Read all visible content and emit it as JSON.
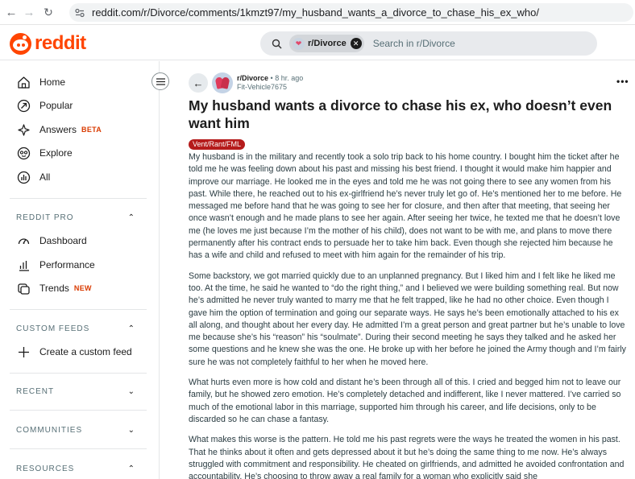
{
  "browser": {
    "url": "reddit.com/r/Divorce/comments/1kmzt97/my_husband_wants_a_divorce_to_chase_his_ex_who/"
  },
  "header": {
    "logo_text": "reddit",
    "search": {
      "chip_label": "r/Divorce",
      "placeholder": "Search in r/Divorce"
    }
  },
  "sidebar": {
    "nav": [
      {
        "label": "Home",
        "icon": "home-icon"
      },
      {
        "label": "Popular",
        "icon": "popular-icon"
      },
      {
        "label": "Answers",
        "badge": "BETA",
        "icon": "answers-icon"
      },
      {
        "label": "Explore",
        "icon": "explore-icon"
      },
      {
        "label": "All",
        "icon": "all-icon"
      }
    ],
    "reddit_pro": {
      "heading": "REDDIT PRO",
      "items": [
        {
          "label": "Dashboard",
          "icon": "dashboard-icon"
        },
        {
          "label": "Performance",
          "icon": "performance-icon"
        },
        {
          "label": "Trends",
          "badge": "NEW",
          "icon": "trends-icon"
        }
      ]
    },
    "custom_feeds": {
      "heading": "CUSTOM FEEDS",
      "create_label": "Create a custom feed"
    },
    "recent_heading": "RECENT",
    "communities_heading": "COMMUNITIES",
    "resources_heading": "RESOURCES"
  },
  "post": {
    "subreddit": "r/Divorce",
    "time": "8 hr. ago",
    "author": "Fit-Vehicle7675",
    "more": "•••",
    "title": "My husband wants a divorce to chase his ex, who doesn’t even want him",
    "flair": "Vent/Rant/FML",
    "paragraphs": [
      "My husband is in the military and recently took a solo trip back to his home country. I bought him the ticket after he told me he was feeling down about his past and missing his best friend. I thought it would make him happier and improve our marriage. He looked me in the eyes and told me he was not going there to see any women from his past. While there, he reached out to his ex-girlfriend he’s never truly let go of. He’s mentioned her to me before. He messaged me before hand that he was going to see her for closure, and then after that meeting, that seeing her once wasn’t enough and he made plans to see her again. After seeing her twice, he texted me that he doesn’t love me (he loves me just because I’m the mother of his child), does not want to be with me, and plans to move there permanently after his contract ends to persuade her to take him back. Even though she rejected him because he has a wife and child and refused to meet with him again for the remainder of his trip.",
      "Some backstory, we got married quickly due to an unplanned pregnancy. But I liked him and I felt like he liked me too. At the time, he said he wanted to “do the right thing,” and I believed we were building something real. But now he’s admitted he never truly wanted to marry me that he felt trapped, like he had no other choice. Even though I gave him the option of termination and going our separate ways. He says he’s been emotionally attached to his ex all along, and thought about her every day. He admitted I’m a great person and great partner but he’s unable to love me because she’s his “reason” his “soulmate”. During their second meeting he says they talked and he asked her some questions and he knew she was the one. He broke up with her before he joined the Army though and I’m fairly sure he was not completely faithful to her when he moved here.",
      "What hurts even more is how cold and distant he’s been through all of this. I cried and begged him not to leave our family, but he showed zero emotion. He’s completely detached and indifferent, like I never mattered. I’ve carried so much of the emotional labor in this marriage, supported him through his career, and life decisions, only to be discarded so he can chase a fantasy.",
      "What makes this worse is the pattern. He told me his past regrets were the ways he treated the women in his past. That he thinks about it often and gets depressed about it but he’s doing the same thing to me now. He’s always struggled with commitment and responsibility. He cheated on girlfriends, and admitted he avoided confrontation and accountability. He’s choosing to throw away a real family for a woman who explicitly said she"
    ]
  }
}
